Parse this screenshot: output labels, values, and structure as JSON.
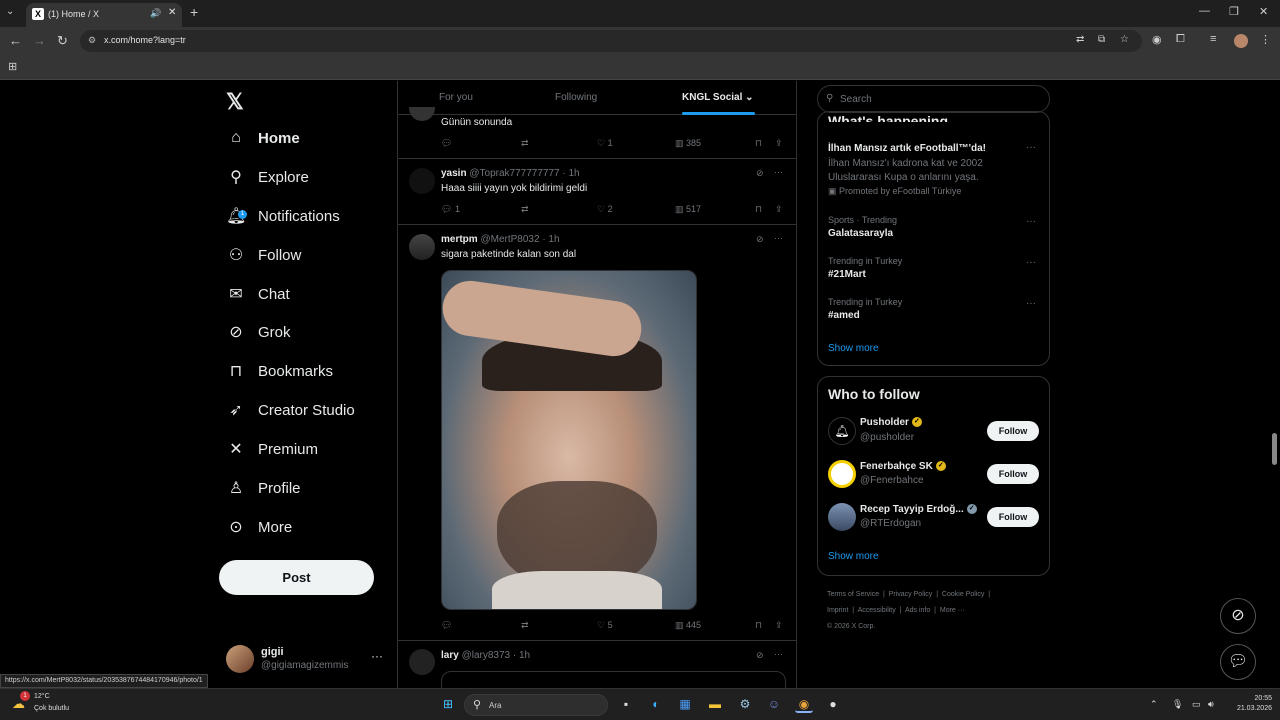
{
  "browser": {
    "tab_title": "(1) Home / X",
    "tab_favicon": "X",
    "url": "x.com/home?lang=tr",
    "status_url": "https://x.com/MertP8032/status/2035387674484170946/photo/1"
  },
  "nav": {
    "items": [
      {
        "label": "Home",
        "icon": "home-icon"
      },
      {
        "label": "Explore",
        "icon": "search-icon"
      },
      {
        "label": "Notifications",
        "icon": "bell-icon"
      },
      {
        "label": "Follow",
        "icon": "person-plus-icon"
      },
      {
        "label": "Chat",
        "icon": "mail-icon"
      },
      {
        "label": "Grok",
        "icon": "grok-icon"
      },
      {
        "label": "Bookmarks",
        "icon": "bookmark-icon"
      },
      {
        "label": "Creator Studio",
        "icon": "rocket-icon"
      },
      {
        "label": "Premium",
        "icon": "x-icon"
      },
      {
        "label": "Profile",
        "icon": "person-icon"
      },
      {
        "label": "More",
        "icon": "more-circle-icon"
      }
    ],
    "notif_count": "1",
    "post_label": "Post",
    "account": {
      "name": "gigii",
      "handle": "@gigiamagizemmis"
    }
  },
  "feed": {
    "tabs": [
      "For you",
      "Following",
      "KNGL Social"
    ],
    "tweets": [
      {
        "text": "Günün sonunda",
        "replies": "",
        "retweets": "",
        "likes": "1",
        "views": "385"
      },
      {
        "name": "yasin",
        "handle": "@Toprak777777777",
        "time": "· 1h",
        "text": "Haaa siiii yayın yok bildirimi geldi",
        "replies": "1",
        "retweets": "",
        "likes": "2",
        "views": "517"
      },
      {
        "name": "mertpm",
        "handle": "@MertP8032",
        "time": "· 1h",
        "text": "sigara paketinde kalan son dal",
        "replies": "",
        "retweets": "",
        "likes": "5",
        "views": "445"
      },
      {
        "name": "lary",
        "handle": "@lary8373",
        "time": "· 1h"
      }
    ]
  },
  "right": {
    "search_placeholder": "Search",
    "happening_title": "What's happening",
    "trends": [
      {
        "name": "İlhan Mansız artık eFootball™'da!",
        "desc": "İlhan Mansız'ı kadrona kat ve 2002 Uluslararası Kupa o anlarını yaşa.",
        "promo": "Promoted by eFootball Türkiye"
      },
      {
        "sub": "Sports · Trending",
        "name": "Galatasarayla"
      },
      {
        "sub": "Trending in Turkey",
        "name": "#21Mart"
      },
      {
        "sub": "Trending in Turkey",
        "name": "#amed"
      }
    ],
    "show_more": "Show more",
    "wtf_title": "Who to follow",
    "follow_suggestions": [
      {
        "name": "Pusholder",
        "handle": "@pusholder"
      },
      {
        "name": "Fenerbahçe SK",
        "handle": "@Fenerbahce"
      },
      {
        "name": "Recep Tayyip Erdoğ...",
        "handle": "@RTErdogan"
      }
    ],
    "follow_label": "Follow",
    "footer": [
      "Terms of Service",
      "Privacy Policy",
      "Cookie Policy",
      "Imprint",
      "Accessibility",
      "Ads info",
      "More ···",
      "© 2026 X Corp."
    ]
  },
  "taskbar": {
    "weather_temp": "12°C",
    "weather_desc": "Çok bulutlu",
    "weather_badge": "1",
    "search_label": "Ara",
    "time": "20:55",
    "date": "21.03.2026"
  }
}
